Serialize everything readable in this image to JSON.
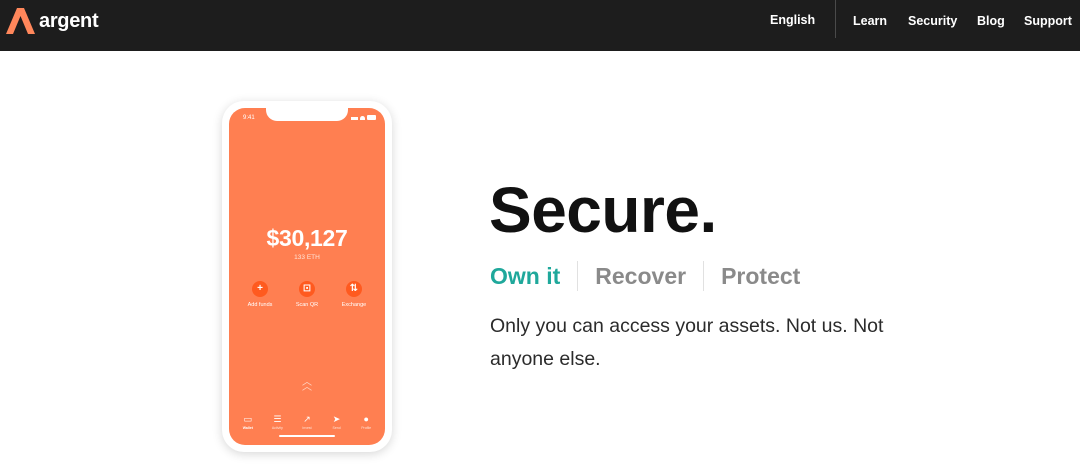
{
  "brand": {
    "name": "argent",
    "accent": "#ff875b"
  },
  "nav": {
    "language": "English",
    "links": [
      "Learn",
      "Security",
      "Blog",
      "Support"
    ],
    "background": "#1d1d1d"
  },
  "phone": {
    "status_time": "9:41",
    "balance": "$30,127",
    "balance_eth": "133 ETH",
    "actions": [
      {
        "label": "Add funds",
        "icon": "plus-icon"
      },
      {
        "label": "Scan QR",
        "icon": "scan-qr-icon"
      },
      {
        "label": "Exchange",
        "icon": "exchange-icon"
      }
    ],
    "tabs": [
      {
        "label": "Wallet",
        "icon": "wallet-icon"
      },
      {
        "label": "Activity",
        "icon": "activity-icon"
      },
      {
        "label": "Invest",
        "icon": "trend-icon"
      },
      {
        "label": "Send",
        "icon": "send-icon"
      },
      {
        "label": "Profile",
        "icon": "profile-icon"
      }
    ],
    "screen_color": "#ff7f51"
  },
  "hero": {
    "headline": "Secure.",
    "tabs": [
      "Own it",
      "Recover",
      "Protect"
    ],
    "active_tab": "Own it",
    "active_color": "#1fa89b",
    "description": "Only you can access your assets. Not us. Not anyone else."
  }
}
